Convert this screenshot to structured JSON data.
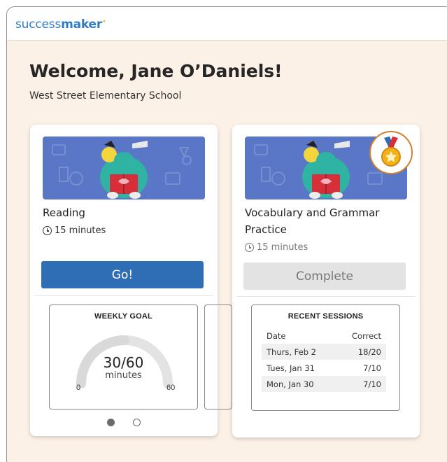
{
  "header": {
    "logo_part1": "success",
    "logo_part2": "maker",
    "logo_mark": "•"
  },
  "welcome": {
    "greeting": "Welcome, Jane O’Daniels!",
    "school": "West Street Elementary School"
  },
  "assignments": [
    {
      "title": "Reading",
      "duration": "15 minutes",
      "button_label": "Go!",
      "illustration": "reading-mascot-illustration",
      "weekly_goal": {
        "title": "WEEKLY GOAL",
        "value": "30/60",
        "unit": "minutes",
        "min": "0",
        "max": "60",
        "progress": 0.5
      },
      "pager": {
        "pages": 2,
        "active": 0
      }
    },
    {
      "title": "Vocabulary and Grammar Practice",
      "duration": "15 minutes",
      "button_label": "Complete",
      "illustration": "reading-mascot-illustration",
      "badge_icon": "medal-icon",
      "recent_sessions": {
        "title": "RECENT SESSIONS",
        "columns": [
          "Date",
          "Correct"
        ],
        "rows": [
          {
            "date": "Thurs, Feb 2",
            "correct": "18/20"
          },
          {
            "date": "Tues, Jan 31",
            "correct": "7/10"
          },
          {
            "date": "Mon, Jan 30",
            "correct": "7/10"
          }
        ]
      }
    }
  ],
  "colors": {
    "brand_blue": "#2f7cc2",
    "go_button": "#2f6db5",
    "page_background": "#fcf1e6",
    "banner": "#5a76c6",
    "medal_ring": "#d2802a"
  }
}
